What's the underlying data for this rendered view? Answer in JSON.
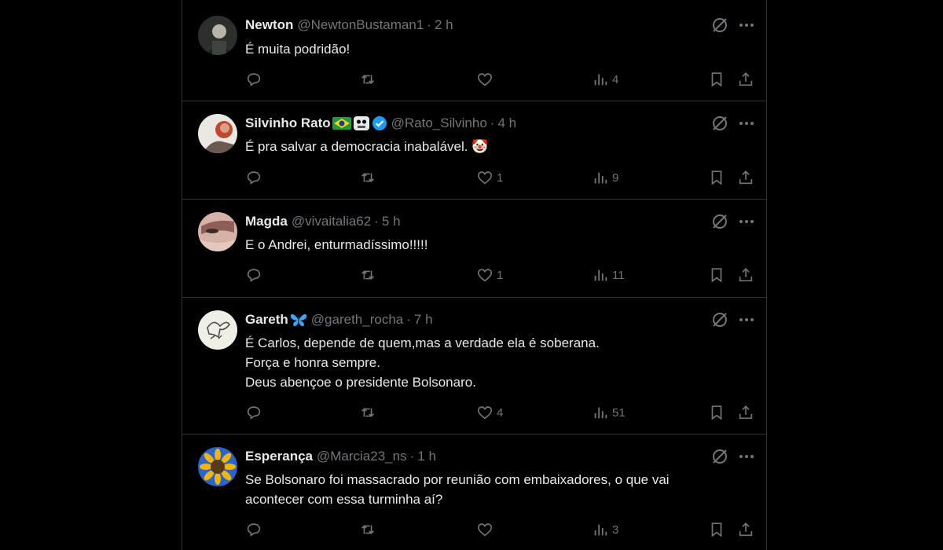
{
  "tweets": [
    {
      "name": "Newton",
      "handle": "@NewtonBustaman1",
      "time": "2 h",
      "lines": [
        "É muita podridão!"
      ],
      "counts": {
        "replies": "",
        "retweets": "",
        "likes": "",
        "views": "4"
      },
      "avatar_colors": [
        "#3a3f3a",
        "#d8d8d0"
      ]
    },
    {
      "name": "Silvinho Rato",
      "handle": "@Rato_Silvinho",
      "time": "4 h",
      "verified": true,
      "lines": [
        "É pra salvar a democracia inabalável. 🤡"
      ],
      "counts": {
        "replies": "",
        "retweets": "",
        "likes": "1",
        "views": "9"
      },
      "avatar_colors": [
        "#e8e4df",
        "#c04a2a"
      ]
    },
    {
      "name": "Magda",
      "handle": "@vivaitalia62",
      "time": "5 h",
      "lines": [
        "E o Andrei, enturmadíssimo!!!!!"
      ],
      "counts": {
        "replies": "",
        "retweets": "",
        "likes": "1",
        "views": "11"
      },
      "avatar_colors": [
        "#d9b7ad",
        "#8a5b55"
      ]
    },
    {
      "name": "Gareth",
      "handle": "@gareth_rocha",
      "time": "7 h",
      "lines": [
        "É Carlos, depende de quem,mas a verdade ela é soberana.",
        "Força e honra sempre.",
        "Deus abençoe o presidente Bolsonaro."
      ],
      "counts": {
        "replies": "",
        "retweets": "",
        "likes": "4",
        "views": "51"
      },
      "avatar_colors": [
        "#f2f0e6",
        "#5b5b50"
      ]
    },
    {
      "name": "Esperança",
      "handle": "@Marcia23_ns",
      "time": "1 h",
      "lines": [
        "Se Bolsonaro foi massacrado por reunião com embaixadores, o que vai",
        "acontecer com essa turminha aí?"
      ],
      "counts": {
        "replies": "",
        "retweets": "",
        "likes": "",
        "views": "3"
      },
      "avatar_colors": [
        "#2a66c9",
        "#f2b410"
      ]
    }
  ],
  "separator": "·",
  "colors": {
    "background": "#000000",
    "text": "#e7e9ea",
    "muted": "#71767b",
    "border": "#2f3336",
    "verified": "#1d9bf0"
  },
  "icons": [
    "reply-icon",
    "retweet-icon",
    "like-icon",
    "views-icon",
    "bookmark-icon",
    "share-icon",
    "grok-icon",
    "more-icon"
  ]
}
